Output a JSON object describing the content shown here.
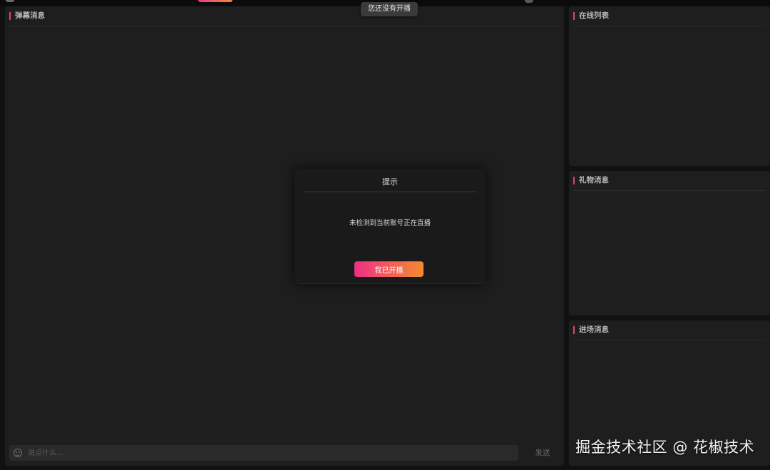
{
  "toast": {
    "text": "您还没有开播"
  },
  "panels": {
    "danmu": {
      "title": "弹幕消息"
    },
    "online": {
      "title": "在线列表"
    },
    "gift": {
      "title": "礼物消息"
    },
    "enter": {
      "title": "进场消息"
    }
  },
  "chat": {
    "placeholder": "说点什么...",
    "value": "",
    "send_label": "发送",
    "emoji_icon": "smiley-icon"
  },
  "modal": {
    "title": "提示",
    "message": "未检测到当前账号正在直播",
    "confirm_label": "我已开播"
  },
  "watermark": {
    "text": "掘金技术社区 @ 花椒技术"
  },
  "colors": {
    "background": "#111111",
    "panel": "#1e1e1e",
    "accent_bar": "#e0455e",
    "button_gradient_start": "#ee2f86",
    "button_gradient_end": "#f58b2e"
  }
}
